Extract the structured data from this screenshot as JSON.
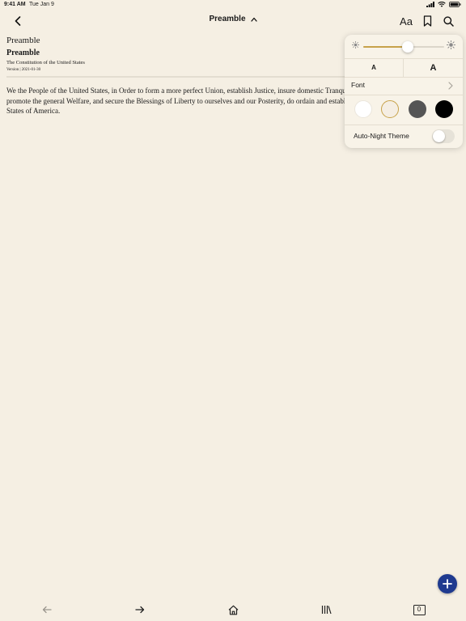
{
  "status_bar": {
    "time": "9:41 AM",
    "date": "Tue Jan 9"
  },
  "nav": {
    "title": "Preamble"
  },
  "reading_settings": {
    "brightness": 0.55,
    "font_small_label": "A",
    "font_large_label": "A",
    "font_label": "Font",
    "themes": [
      {
        "name": "white",
        "color": "#ffffff"
      },
      {
        "name": "sepia",
        "color": "#f5eee3",
        "selected": true
      },
      {
        "name": "gray",
        "color": "#555555"
      },
      {
        "name": "black",
        "color": "#000000"
      }
    ],
    "auto_night_label": "Auto-Night Theme",
    "auto_night_enabled": false,
    "accent_color": "#c7a24a"
  },
  "document": {
    "section": "Preamble",
    "title": "Preamble",
    "subtitle": "The Constitution of the United States",
    "version": "Version | 2021-01-30",
    "body": "We the People of the United States, in Order to form a more perfect Union, establish Justice, insure domestic Tranquility, provide for the common defence, promote the general Welfare, and secure the Blessings of Liberty to ourselves and our Posterity, do ordain and establish this Constitution for the United States of America."
  },
  "toolbar": {
    "tab_count": "0",
    "fab_color": "#1f3a8f"
  }
}
